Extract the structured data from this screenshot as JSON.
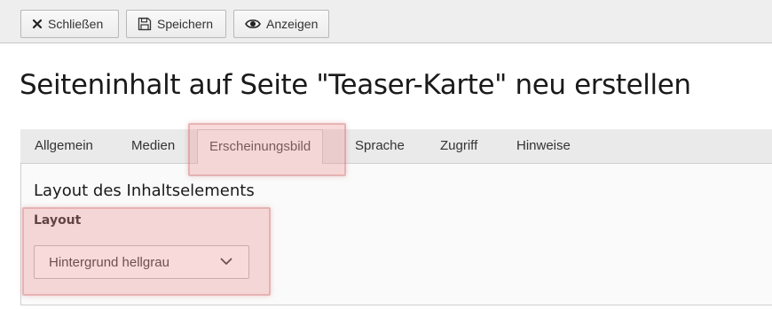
{
  "toolbar": {
    "buttons": [
      {
        "label": "Schließen",
        "icon": "close-icon"
      },
      {
        "label": "Speichern",
        "icon": "save-icon"
      },
      {
        "label": "Anzeigen",
        "icon": "eye-icon"
      }
    ]
  },
  "page": {
    "title": "Seiteninhalt auf Seite \"Teaser-Karte\" neu erstellen"
  },
  "tabs": [
    {
      "label": "Allgemein"
    },
    {
      "label": "Medien"
    },
    {
      "label": "Erscheinungsbild",
      "active": true
    },
    {
      "label": "Sprache"
    },
    {
      "label": "Zugriff"
    },
    {
      "label": "Hinweise"
    }
  ],
  "panel": {
    "section_title": "Layout des Inhaltselements",
    "field_label": "Layout",
    "select_value": "Hintergrund hellgrau",
    "select_icon": "chevron-down-icon"
  },
  "colors": {
    "highlight": "#eb8c8c",
    "toolbar_bg": "#eeeeee",
    "tabbar_bg": "#eaeaea"
  }
}
